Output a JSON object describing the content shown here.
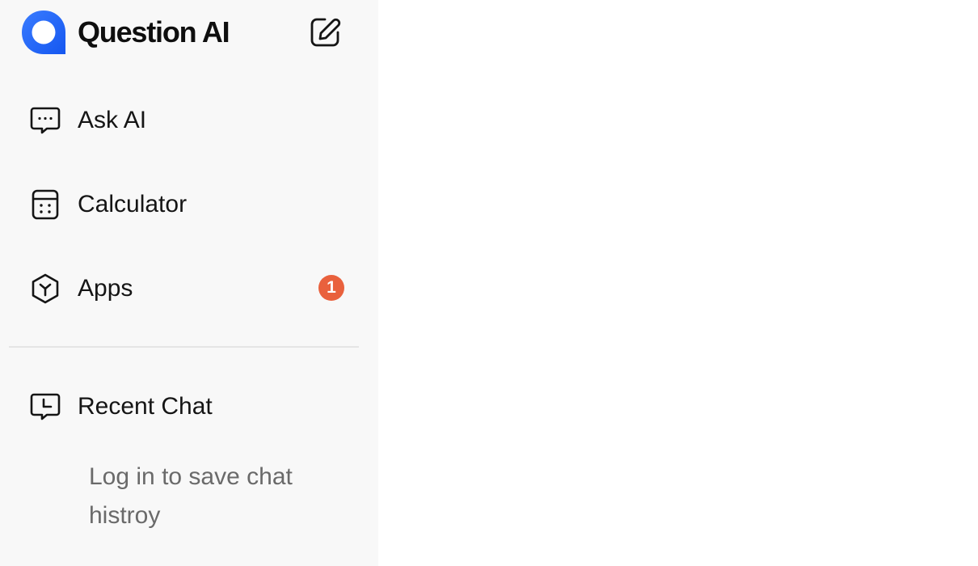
{
  "brand": {
    "name": "Question AI",
    "logo_icon": "question-ai-logo",
    "accent": "#2d6bff"
  },
  "header": {
    "new_chat_icon": "edit-icon"
  },
  "nav": {
    "items": [
      {
        "label": "Ask AI",
        "icon": "chat-dots-icon"
      },
      {
        "label": "Calculator",
        "icon": "calculator-icon"
      },
      {
        "label": "Apps",
        "icon": "hexagon-y-icon",
        "badge": "1",
        "badge_color": "#e9613d"
      }
    ]
  },
  "recent": {
    "title": "Recent Chat",
    "icon": "chat-clock-icon",
    "empty_message": "Log in to save chat histroy"
  }
}
